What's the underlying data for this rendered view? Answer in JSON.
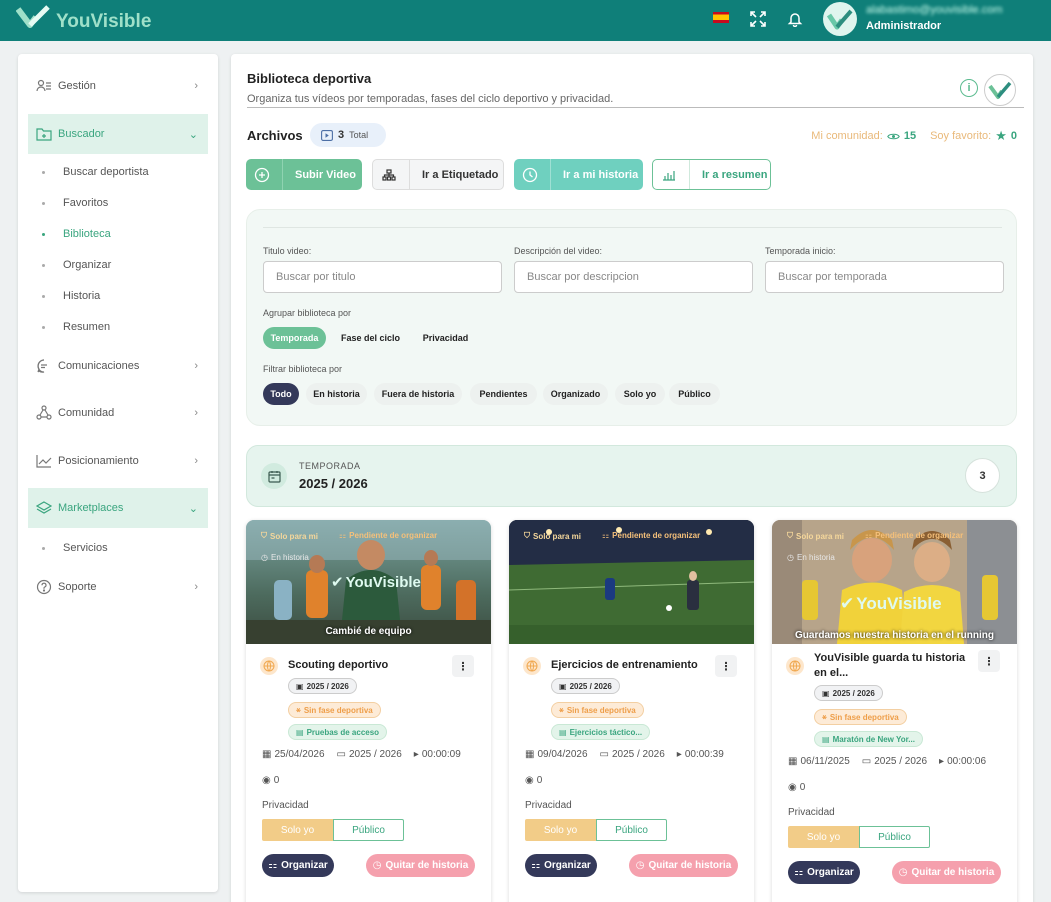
{
  "app": {
    "brand": "YouVisible",
    "user_email": "alabastimo@youvisible.com",
    "user_role": "Administrador",
    "colors": {
      "topbar": "#0f7f79",
      "accent": "#6cc197",
      "dark": "#34395a",
      "warning": "#f2cc88",
      "danger": "#f5a0ad"
    }
  },
  "sidebar": {
    "items": [
      {
        "label": "Gestión",
        "icon": "users-list-icon"
      },
      {
        "label": "Buscador",
        "icon": "folder-search-icon",
        "active": true
      },
      {
        "label": "Comunicaciones",
        "icon": "chat-icon"
      },
      {
        "label": "Comunidad",
        "icon": "network-icon"
      },
      {
        "label": "Posicionamiento",
        "icon": "chart-line-icon"
      },
      {
        "label": "Marketplaces",
        "icon": "layers-icon",
        "active": true
      },
      {
        "label": "Soporte",
        "icon": "help-icon"
      }
    ],
    "buscador_sub": [
      "Buscar deportista",
      "Favoritos",
      "Biblioteca",
      "Organizar",
      "Historia",
      "Resumen"
    ],
    "marketplaces_sub": [
      "Servicios"
    ]
  },
  "page": {
    "title": "Biblioteca deportiva",
    "subtitle": "Organiza tus vídeos por temporadas, fases del ciclo deportivo y privacidad.",
    "archivos": "Archivos",
    "total_count": "3",
    "total_label": "Total",
    "community_label": "Mi comunidad:",
    "community_count": "15",
    "fav_label": "Soy favorito:",
    "fav_count": "0"
  },
  "actions": {
    "upload": "Subir Video",
    "tag": "Ir a Etiquetado",
    "history": "Ir a mi historia",
    "summary": "Ir a resumen"
  },
  "filters": {
    "title_label": "Titulo video:",
    "title_placeholder": "Buscar por titulo",
    "desc_label": "Descripción del video:",
    "desc_placeholder": "Buscar por descripcion",
    "season_label": "Temporada inicio:",
    "season_placeholder": "Buscar por temporada",
    "group_label": "Agrupar biblioteca por",
    "group_options": [
      "Temporada",
      "Fase del ciclo",
      "Privacidad"
    ],
    "group_selected": "Temporada",
    "filter_label": "Filtrar biblioteca por",
    "filter_options": [
      "Todo",
      "En historia",
      "Fuera de historia",
      "Pendientes",
      "Organizado",
      "Solo yo",
      "Público"
    ],
    "filter_selected": "Todo"
  },
  "season": {
    "label": "TEMPORADA",
    "value": "2025 / 2026",
    "count": "3"
  },
  "cards": [
    {
      "tag_private": "Solo para mi",
      "tag_pending": "Pendiente de organizar",
      "tag_history": "En historia",
      "caption": "Cambié de equipo",
      "title": "Scouting deportivo",
      "season": "2025 / 2026",
      "fase": "Sin fase deportiva",
      "fase2": "Pruebas de acceso",
      "date": "25/04/2026",
      "meta_season": "2025 / 2026",
      "duration": "00:00:09",
      "views": "0",
      "privacy_label": "Privacidad",
      "priv_a": "Solo yo",
      "priv_b": "Público",
      "organize": "Organizar",
      "remove": "Quitar de historia"
    },
    {
      "tag_private": "Solo para mi",
      "tag_pending": "Pendiente de organizar",
      "tag_history": "",
      "caption": "",
      "title": "Ejercicios de entrenamiento",
      "season": "2025 / 2026",
      "fase": "Sin fase deportiva",
      "fase2": "Ejercicios táctico...",
      "date": "09/04/2026",
      "meta_season": "2025 / 2026",
      "duration": "00:00:39",
      "views": "0",
      "privacy_label": "Privacidad",
      "priv_a": "Solo yo",
      "priv_b": "Público",
      "organize": "Organizar",
      "remove": "Quitar de historia"
    },
    {
      "tag_private": "Solo para mi",
      "tag_pending": "Pendiente de organizar",
      "tag_history": "En historia",
      "caption": "Guardamos nuestra historia en el running",
      "title": "YouVisible guarda tu historia en el...",
      "season": "2025 / 2026",
      "fase": "Sin fase deportiva",
      "fase2": "Maratón de New Yor...",
      "date": "06/11/2025",
      "meta_season": "2025 / 2026",
      "duration": "00:00:06",
      "views": "0",
      "privacy_label": "Privacidad",
      "priv_a": "Solo yo",
      "priv_b": "Público",
      "organize": "Organizar",
      "remove": "Quitar de historia"
    }
  ]
}
